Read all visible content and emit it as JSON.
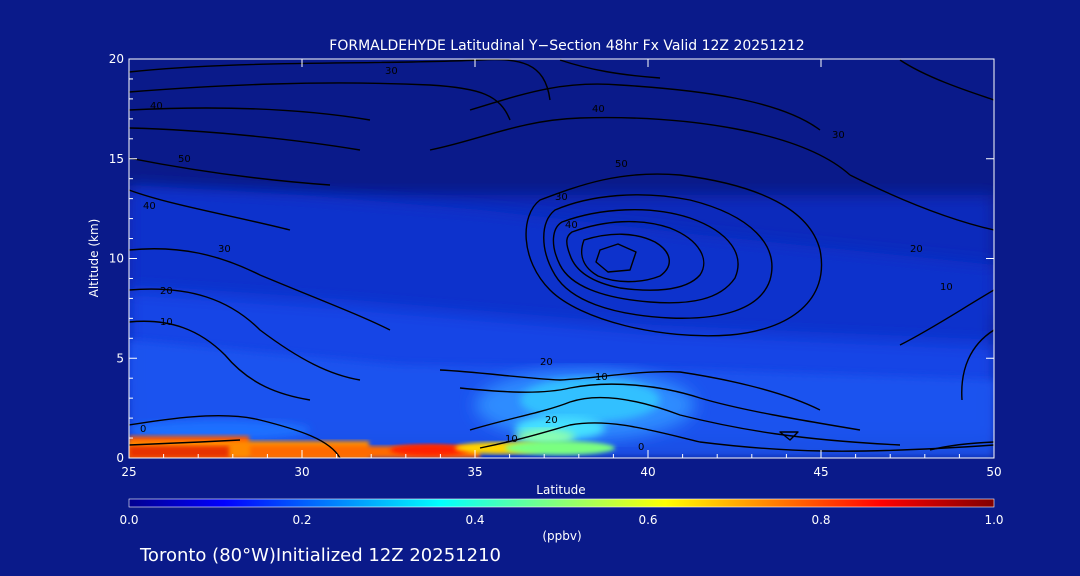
{
  "chart_data": {
    "type": "heatmap",
    "title": "FORMALDEHYDE Latitudinal Y−Section 48hr  Fx Valid 12Z 20251212",
    "xlabel": "Latitude",
    "ylabel": "Altitude (km)",
    "xlim": [
      25,
      50
    ],
    "ylim": [
      0,
      20
    ],
    "x_ticks": [
      "25",
      "30",
      "35",
      "40",
      "45",
      "50"
    ],
    "y_ticks": [
      "0",
      "5",
      "10",
      "15",
      "20"
    ],
    "colorbar": {
      "label": "(ppbv)",
      "range": [
        0.0,
        1.0
      ],
      "ticks": [
        "0.0",
        "0.2",
        "0.4",
        "0.6",
        "0.8",
        "1.0"
      ],
      "colormap": "jet",
      "background_color": "#0a1a8a"
    },
    "contour_labels": [
      "0",
      "10",
      "20",
      "30",
      "40",
      "50",
      "40",
      "30",
      "20",
      "10",
      "0",
      "10",
      "20",
      "30",
      "40",
      "50",
      "40",
      "30",
      "20",
      "10"
    ],
    "footer": "Toronto (80°W)Initialized 12Z 20251210"
  }
}
